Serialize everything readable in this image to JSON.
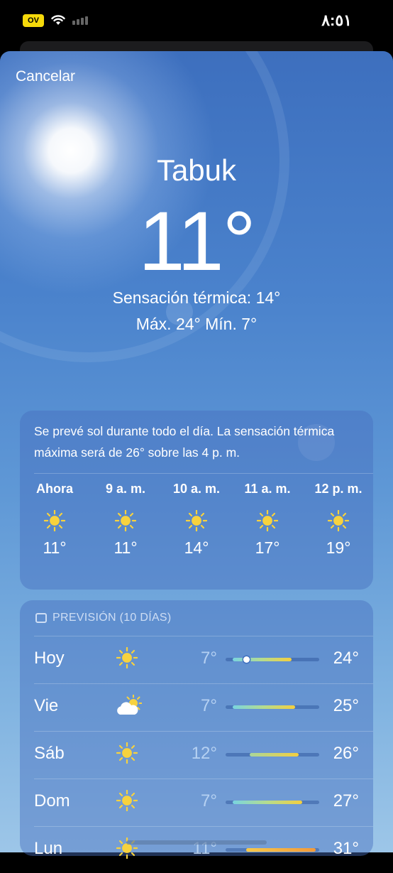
{
  "status_bar": {
    "battery_label": "OV",
    "time": "٨:٥١"
  },
  "cancel_label": "Cancelar",
  "location": {
    "city": "Tabuk",
    "temperature": "11°",
    "feels_like": "Sensación térmica: 14°",
    "high_low": "Máx. 24°  Mín. 7°"
  },
  "hourly": {
    "summary": "Se prevé sol durante todo el día. La sensación térmica máxima será de 26° sobre las 4 p. m.",
    "items": [
      {
        "time": "Ahora",
        "icon": "sun-icon",
        "temp": "11°"
      },
      {
        "time": "9 a. m.",
        "icon": "sun-icon",
        "temp": "11°"
      },
      {
        "time": "10 a. m.",
        "icon": "sun-icon",
        "temp": "14°"
      },
      {
        "time": "11 a. m.",
        "icon": "sun-icon",
        "temp": "17°"
      },
      {
        "time": "12 p. m.",
        "icon": "sun-icon",
        "temp": "19°"
      }
    ]
  },
  "daily": {
    "header": "PREVISIÓN (10 DÍAS)",
    "header_icon": "calendar-icon",
    "days": [
      {
        "day": "Hoy",
        "icon": "sun-icon",
        "low": "7°",
        "high": "24°",
        "range": [
          7,
          24
        ],
        "current": 11
      },
      {
        "day": "Vie",
        "icon": "partly-cloudy-icon",
        "low": "7°",
        "high": "25°",
        "range": [
          7,
          25
        ]
      },
      {
        "day": "Sáb",
        "icon": "sun-icon",
        "low": "12°",
        "high": "26°",
        "range": [
          12,
          26
        ]
      },
      {
        "day": "Dom",
        "icon": "sun-icon",
        "low": "7°",
        "high": "27°",
        "range": [
          7,
          27
        ]
      },
      {
        "day": "Lun",
        "icon": "sun-icon",
        "low": "11°",
        "high": "31°",
        "range": [
          11,
          31
        ]
      }
    ],
    "scale": [
      5,
      32
    ]
  },
  "colors": {
    "sun": "#f7d23e",
    "sky_top": "#3d6fbe",
    "sky_bottom": "#9dc6e8"
  }
}
